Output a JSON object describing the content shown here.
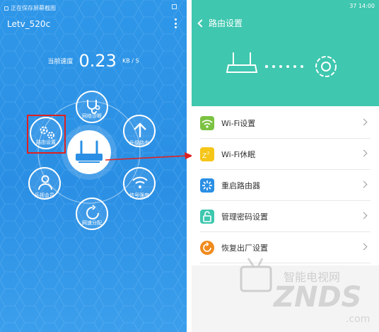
{
  "left": {
    "status_text": "正在保存屏幕截图",
    "title": "Letv_520c",
    "speed_label": "当前速度",
    "speed_value": "0.23",
    "speed_unit": "KB / S",
    "buttons": [
      {
        "label": "网络诊断",
        "icon": "stethoscope-icon"
      },
      {
        "label": "升级路由",
        "icon": "arrow-up-icon"
      },
      {
        "label": "信号强度",
        "icon": "wifi-icon"
      },
      {
        "label": "网速分配",
        "icon": "speed-refresh-icon"
      },
      {
        "label": "乐视会员",
        "icon": "user-icon"
      },
      {
        "label": "路由设置",
        "icon": "gears-icon"
      }
    ]
  },
  "right": {
    "status_left": "",
    "status_right": "37 14:00",
    "title": "路由设置",
    "menu": [
      {
        "label": "Wi-Fi设置",
        "icon": "wifi-icon",
        "color": "#7cc242"
      },
      {
        "label": "Wi-Fi休眠",
        "icon": "sleep-icon",
        "color": "#f5c518"
      },
      {
        "label": "重启路由器",
        "icon": "restart-icon",
        "color": "#2a8fe4"
      },
      {
        "label": "管理密码设置",
        "icon": "lock-icon",
        "color": "#3fc7af"
      },
      {
        "label": "恢复出厂设置",
        "icon": "reset-icon",
        "color": "#f08a1c"
      }
    ]
  },
  "watermark": {
    "title": "智能电视网",
    "brand": "ZNDS",
    "domain": ".com"
  },
  "colors": {
    "left_bg": "#2f97e8",
    "right_header": "#3fc7af",
    "highlight": "#e02020"
  }
}
